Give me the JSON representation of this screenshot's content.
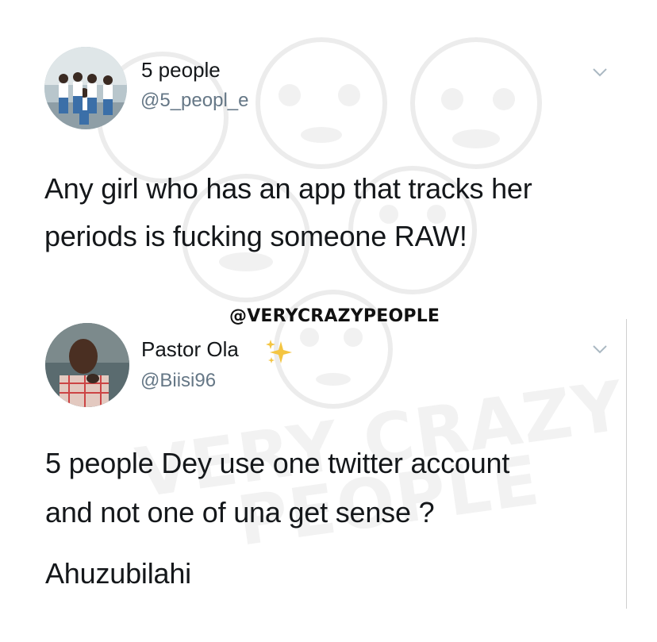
{
  "watermark": {
    "brand": "@VERYCRAZYPEOPLE"
  },
  "tweets": [
    {
      "name": "5 people",
      "handle": "@5_peopl_e",
      "text": "Any girl who has an app that tracks her periods is fucking someone RAW!",
      "text_lines": [
        "Any girl who has an app that tracks her",
        "periods is fucking someone RAW!"
      ]
    },
    {
      "name": "Pastor Ola",
      "handle": "@Biisi96",
      "text_lines": [
        "5 people Dey use one twitter account",
        "and not one of una get sense ?"
      ],
      "text_extra": "Ahuzubilahi"
    }
  ],
  "colors": {
    "text": "#14171a",
    "handle": "#657786",
    "chevron": "#aab8c2",
    "sparkle": "#f4c542"
  }
}
